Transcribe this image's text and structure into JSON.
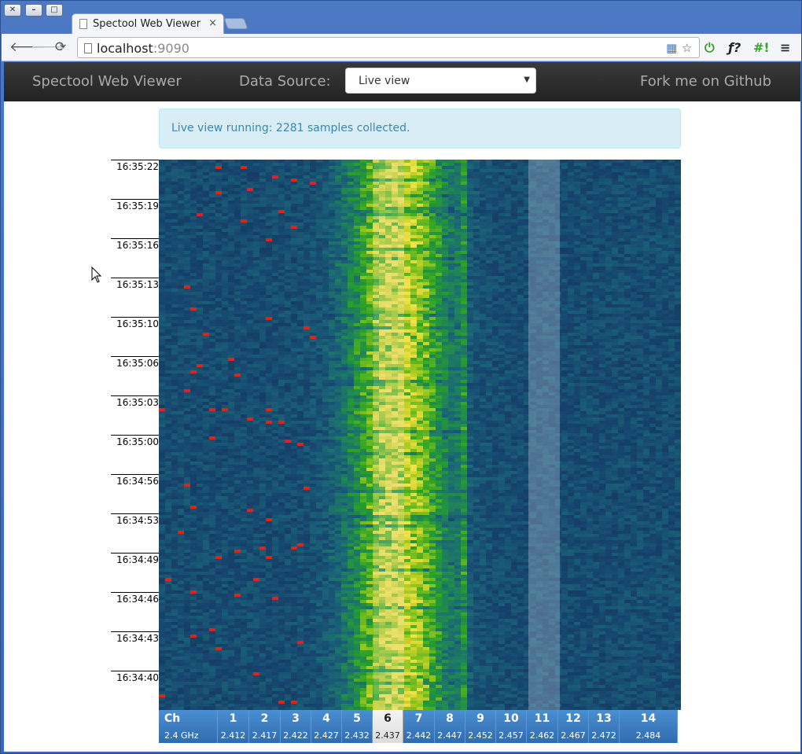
{
  "window": {
    "tab_title": "Spectool Web Viewer",
    "tab_close": "×"
  },
  "toolbar": {
    "back_icon": "arrow-left-icon",
    "forward_icon": "arrow-right-icon",
    "reload_icon": "reload-icon",
    "url_host": "localhost",
    "url_port": ":9090"
  },
  "navbar": {
    "brand": "Spectool Web Viewer",
    "data_source_label": "Data Source:",
    "data_source_value": "Live view",
    "fork_link": "Fork me on Github"
  },
  "alert": {
    "text": "Live view running: 2281 samples collected."
  },
  "time_axis": {
    "labels": [
      "16:35:22",
      "16:35:19",
      "16:35:16",
      "16:35:13",
      "16:35:10",
      "16:35:06",
      "16:35:03",
      "16:35:00",
      "16:34:56",
      "16:34:53",
      "16:34:49",
      "16:34:46",
      "16:34:43",
      "16:34:40"
    ]
  },
  "channels": {
    "header": {
      "label": "Ch",
      "band": "2.4 GHz"
    },
    "selected": "6",
    "highlighted": "11",
    "items": [
      {
        "num": "1",
        "freq": "2.412"
      },
      {
        "num": "2",
        "freq": "2.417"
      },
      {
        "num": "3",
        "freq": "2.422"
      },
      {
        "num": "4",
        "freq": "2.427"
      },
      {
        "num": "5",
        "freq": "2.432"
      },
      {
        "num": "6",
        "freq": "2.437"
      },
      {
        "num": "7",
        "freq": "2.442"
      },
      {
        "num": "8",
        "freq": "2.447"
      },
      {
        "num": "9",
        "freq": "2.452"
      },
      {
        "num": "10",
        "freq": "2.457"
      },
      {
        "num": "11",
        "freq": "2.462"
      },
      {
        "num": "12",
        "freq": "2.467"
      },
      {
        "num": "13",
        "freq": "2.472"
      },
      {
        "num": "14",
        "freq": "2.484"
      }
    ]
  },
  "colors": {
    "navbar_bg": "#222222",
    "alert_bg": "#d9edf7",
    "alert_text": "#3a87ad",
    "waterfall_low": "#14325c",
    "waterfall_high": "#f0e24a",
    "channel_bar": "#3a7cc1"
  }
}
